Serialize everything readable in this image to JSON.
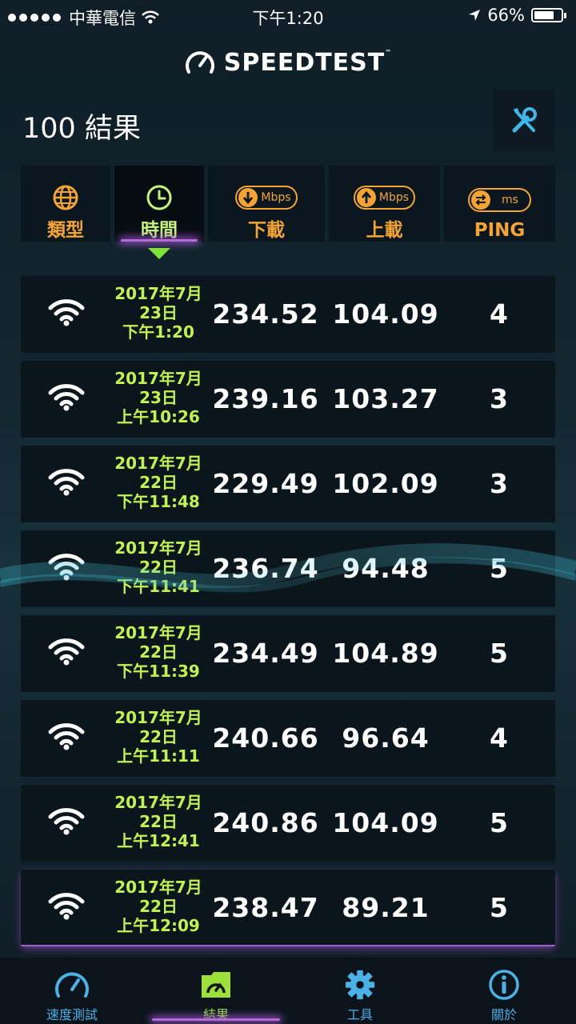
{
  "status_bar": {
    "carrier": "中華電信",
    "time": "下午1:20",
    "battery": "66%"
  },
  "app": {
    "logo": "SPEEDTEST",
    "trademark": "™"
  },
  "page": {
    "title": "100 結果"
  },
  "columns": {
    "type": "類型",
    "time": "時間",
    "download": "下載",
    "upload": "上載",
    "ping": "PING",
    "download_unit": "Mbps",
    "upload_unit": "Mbps",
    "ping_unit": "ms"
  },
  "results": [
    {
      "date_line1": "2017年7月",
      "date_line2": "23日",
      "date_line3": "下午1:20",
      "download": "234.52",
      "upload": "104.09",
      "ping": "4"
    },
    {
      "date_line1": "2017年7月",
      "date_line2": "23日",
      "date_line3": "上午10:26",
      "download": "239.16",
      "upload": "103.27",
      "ping": "3"
    },
    {
      "date_line1": "2017年7月",
      "date_line2": "22日",
      "date_line3": "下午11:48",
      "download": "229.49",
      "upload": "102.09",
      "ping": "3"
    },
    {
      "date_line1": "2017年7月",
      "date_line2": "22日",
      "date_line3": "下午11:41",
      "download": "236.74",
      "upload": "94.48",
      "ping": "5"
    },
    {
      "date_line1": "2017年7月",
      "date_line2": "22日",
      "date_line3": "下午11:39",
      "download": "234.49",
      "upload": "104.89",
      "ping": "5"
    },
    {
      "date_line1": "2017年7月",
      "date_line2": "22日",
      "date_line3": "上午11:11",
      "download": "240.66",
      "upload": "96.64",
      "ping": "4"
    },
    {
      "date_line1": "2017年7月",
      "date_line2": "22日",
      "date_line3": "上午12:41",
      "download": "240.86",
      "upload": "104.09",
      "ping": "5"
    },
    {
      "date_line1": "2017年7月",
      "date_line2": "22日",
      "date_line3": "上午12:09",
      "download": "238.47",
      "upload": "89.21",
      "ping": "5"
    }
  ],
  "nav": {
    "speedtest": "速度測試",
    "results": "結果",
    "tools": "工具",
    "about": "關於"
  },
  "colors": {
    "accent_orange": "#f5a433",
    "accent_green": "#c2f252",
    "nav_blue": "#4bb2e8",
    "glow_purple": "#b36bd8"
  }
}
